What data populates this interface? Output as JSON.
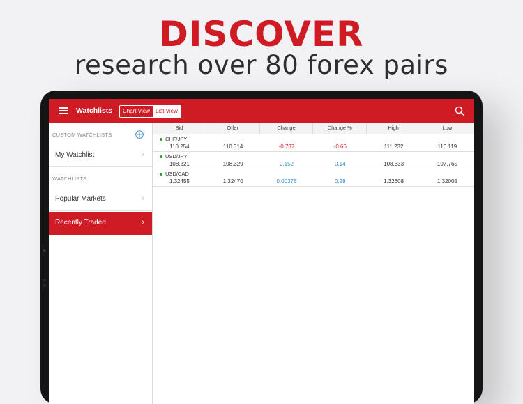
{
  "promo": {
    "headline": "DISCOVER",
    "subline": "research over 80 forex pairs"
  },
  "app": {
    "title": "Watchlists",
    "view_toggle": {
      "chart_label": "Chart View",
      "list_label": "List View",
      "selected": "List View"
    },
    "icons": {
      "menu": "hamburger-icon",
      "search": "search-icon",
      "add": "plus-circle-icon"
    },
    "colors": {
      "brand": "#cf1c24",
      "negative": "#cf1c24",
      "positive": "#2f8fc9",
      "status_dot": "#2e9e3e"
    }
  },
  "sidebar": {
    "custom_heading": "CUSTOM WATCHLISTS",
    "custom_items": [
      {
        "label": "My Watchlist"
      }
    ],
    "watchlists_heading": "WATCHLISTS",
    "watchlist_items": [
      {
        "label": "Popular Markets",
        "selected": false
      },
      {
        "label": "Recently Traded",
        "selected": true
      }
    ]
  },
  "table": {
    "columns": [
      "Bid",
      "Offer",
      "Change",
      "Change %",
      "High",
      "Low"
    ],
    "rows": [
      {
        "pair": "CHF/JPY",
        "bid": "110.254",
        "offer": "110.314",
        "change": "-0.737",
        "change_pct": "-0.66",
        "high": "111.232",
        "low": "110.119",
        "direction": "down"
      },
      {
        "pair": "USD/JPY",
        "bid": "108.321",
        "offer": "108.329",
        "change": "0.152",
        "change_pct": "0.14",
        "high": "108.333",
        "low": "107.765",
        "direction": "up"
      },
      {
        "pair": "USD/CAD",
        "bid": "1.32455",
        "offer": "1.32470",
        "change": "0.00376",
        "change_pct": "0.28",
        "high": "1.32608",
        "low": "1.32005",
        "direction": "up"
      }
    ]
  }
}
